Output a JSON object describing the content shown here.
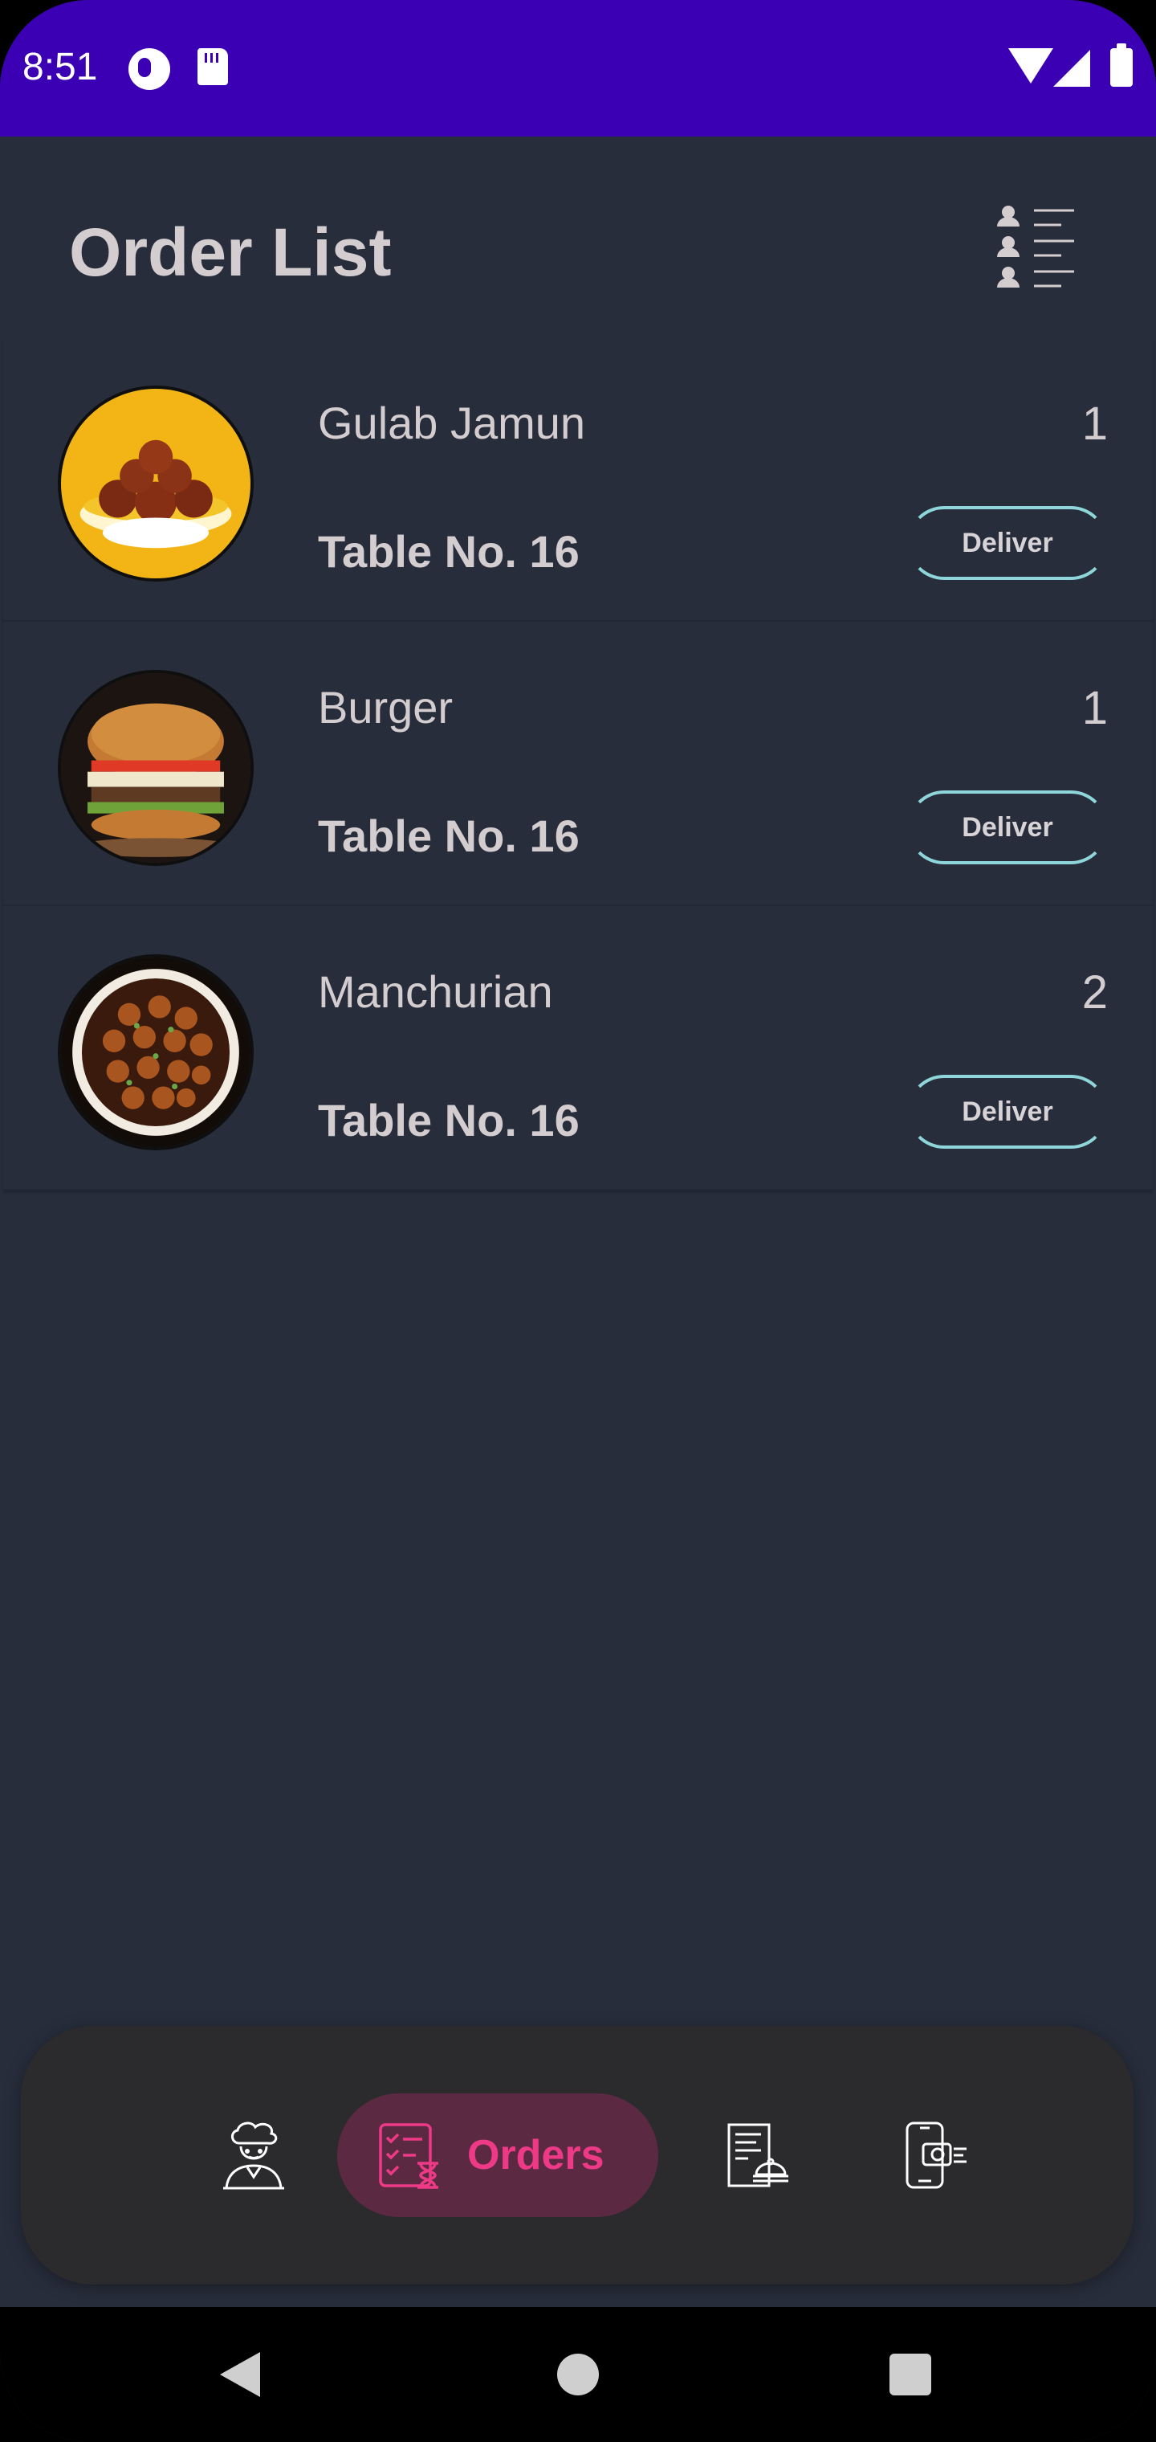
{
  "status_bar": {
    "time": "8:51",
    "icons": [
      "sync-ring-icon",
      "sd-card-icon",
      "wifi-icon",
      "cell-signal-icon",
      "battery-icon"
    ]
  },
  "header": {
    "title": "Order List",
    "filter_icon": "people-list-icon"
  },
  "orders": [
    {
      "name": "Gulab Jamun",
      "quantity": "1",
      "table": "Table No. 16",
      "action": "Deliver",
      "image": "gulab-jamun"
    },
    {
      "name": "Burger",
      "quantity": "1",
      "table": "Table No. 16",
      "action": "Deliver",
      "image": "burger"
    },
    {
      "name": "Manchurian",
      "quantity": "2",
      "table": "Table No. 16",
      "action": "Deliver",
      "image": "manchurian"
    }
  ],
  "bottom_nav": {
    "items": [
      {
        "icon": "chef-icon"
      },
      {
        "icon": "orders-checklist-icon",
        "label": "Orders",
        "active": true
      },
      {
        "icon": "menu-card-icon"
      },
      {
        "icon": "mobile-payment-icon"
      }
    ]
  },
  "colors": {
    "status_bar": "#3b00b3",
    "background": "#272d3b",
    "text": "#d4cdd0",
    "deliver_border": "#8ed6d9",
    "nav_bg": "#2b2b2d",
    "active_pill": "#5b2a42",
    "active_accent": "#ee3a86"
  }
}
